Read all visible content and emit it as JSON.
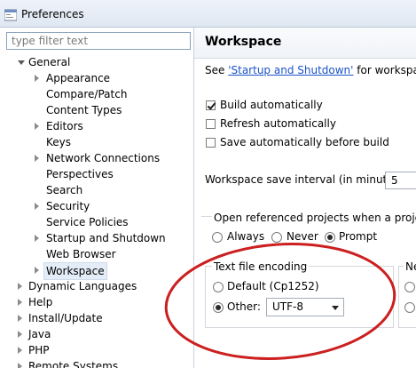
{
  "window": {
    "title": "Preferences"
  },
  "filter": {
    "placeholder": "type filter text"
  },
  "tree": {
    "general": "General",
    "general_children": [
      "Appearance",
      "Compare/Patch",
      "Content Types",
      "Editors",
      "Keys",
      "Network Connections",
      "Perspectives",
      "Search",
      "Security",
      "Service Policies",
      "Startup and Shutdown",
      "Web Browser",
      "Workspace"
    ],
    "top_level": [
      "Dynamic Languages",
      "Help",
      "Install/Update",
      "Java",
      "PHP",
      "Remote Systems"
    ]
  },
  "page": {
    "title": "Workspace",
    "see_prefix": "See ",
    "see_link": "'Startup and Shutdown'",
    "see_suffix": " for workspace sta",
    "build_automatically": "Build automatically",
    "refresh_automatically": "Refresh automatically",
    "save_before_build": "Save automatically before build",
    "save_interval_label": "Workspace save interval (in minutes):",
    "save_interval_value": "5",
    "open_projects_label": "Open referenced projects when a project is",
    "open_always": "Always",
    "open_never": "Never",
    "open_prompt": "Prompt",
    "encoding_label": "Text file encoding",
    "encoding_default": "Default (Cp1252)",
    "encoding_other": "Other:",
    "encoding_value": "UTF-8",
    "second_group_label": "Ne"
  },
  "state": {
    "build_automatically": true,
    "refresh_automatically": false,
    "save_before_build": false,
    "open_projects_selected": "Prompt",
    "encoding_selected": "Other"
  },
  "colors": {
    "highlight_ellipse": "#cc1f1f",
    "link": "#1a53c6"
  }
}
